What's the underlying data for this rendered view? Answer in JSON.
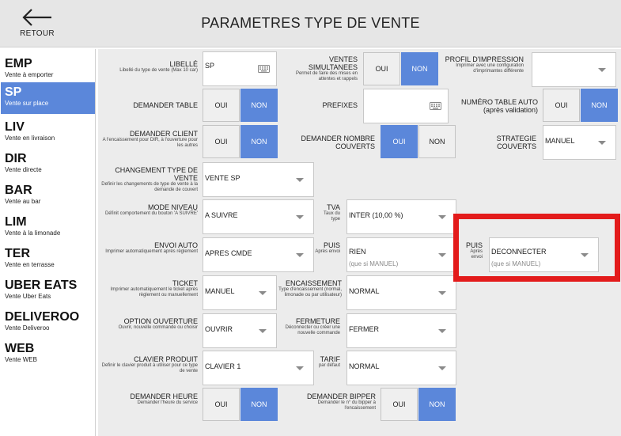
{
  "header": {
    "back_label": "RETOUR",
    "title": "PARAMETRES TYPE DE VENTE"
  },
  "sidebar": {
    "items": [
      {
        "code": "EMP",
        "label": "Vente à emporter"
      },
      {
        "code": "SP",
        "label": "Vente sur place"
      },
      {
        "code": "LIV",
        "label": "Vente en livraison"
      },
      {
        "code": "DIR",
        "label": "Vente directe"
      },
      {
        "code": "BAR",
        "label": "Vente au bar"
      },
      {
        "code": "LIM",
        "label": "Vente à la limonade"
      },
      {
        "code": "TER",
        "label": "Vente en terrasse"
      },
      {
        "code": "UBER EATS",
        "label": "Vente Uber Eats"
      },
      {
        "code": "DELIVEROO",
        "label": "Vente Deliveroo"
      },
      {
        "code": "WEB",
        "label": "Vente WEB"
      }
    ],
    "active_index": 1
  },
  "form": {
    "libelle": {
      "title": "LIBELLÉ",
      "desc": "Libellé du type de vente (Max 10 car)",
      "value": "SP"
    },
    "ventes_simultanees": {
      "title": "VENTES SIMULTANEES",
      "desc": "Permet de faire des mises en attentes et rappels",
      "oui": "OUI",
      "non": "NON"
    },
    "profil_impression": {
      "title": "PROFIL D'IMPRESSION",
      "desc": "Imprimer avec une configuration d'imprimantes différente",
      "value": ""
    },
    "demander_table": {
      "title": "DEMANDER TABLE",
      "oui": "OUI",
      "non": "NON"
    },
    "prefixes": {
      "title": "PREFIXES",
      "value": ""
    },
    "numero_table_auto": {
      "title": "NUMÉRO TABLE AUTO",
      "desc": "(après validation)",
      "oui": "OUI",
      "non": "NON"
    },
    "demander_client": {
      "title": "DEMANDER CLIENT",
      "desc": "A l'encaissement pour DIR, à l'ouverture pour les autres",
      "oui": "OUI",
      "non": "NON"
    },
    "demander_nombre_couverts": {
      "title": "DEMANDER NOMBRE COUVERTS",
      "oui": "OUI",
      "non": "NON"
    },
    "strategie_couverts": {
      "title": "STRATEGIE COUVERTS",
      "value": "MANUEL"
    },
    "changement_type_vente": {
      "title": "CHANGEMENT TYPE DE VENTE",
      "desc": "Definir les changements de type de vente à la demande de couvert",
      "value": "VENTE SP"
    },
    "mode_niveau": {
      "title": "MODE NIVEAU",
      "desc": "Définit comportement du bouton 'A SUIVRE'",
      "value": "A SUIVRE"
    },
    "tva": {
      "title": "TVA",
      "desc": "Taux du type",
      "value": "INTER (10,00 %)"
    },
    "envoi_auto": {
      "title": "ENVOI AUTO",
      "desc": "Imprimer automatiquement après règlement",
      "value": "APRES CMDE"
    },
    "puis_1": {
      "title": "PUIS",
      "desc": "Après envoi",
      "value": "RIEN",
      "hint": "(que si MANUEL)"
    },
    "puis_2": {
      "title": "PUIS",
      "desc": "Après envoi",
      "value": "DECONNECTER",
      "hint": "(que si MANUEL)"
    },
    "ticket": {
      "title": "TICKET",
      "desc": "Imprimer automatiquement le ticket après règlement ou manuellement",
      "value": "MANUEL"
    },
    "encaissement": {
      "title": "ENCAISSEMENT",
      "desc": "Type d'encaissement (normal, limonade ou par utilisateur)",
      "value": "NORMAL"
    },
    "option_ouverture": {
      "title": "OPTION OUVERTURE",
      "desc": "Ouvrir, nouvelle commande ou choisir",
      "value": "OUVRIR"
    },
    "fermeture": {
      "title": "FERMETURE",
      "desc": "Déconnecter ou créer une nouvelle commande",
      "value": "FERMER"
    },
    "clavier_produit": {
      "title": "CLAVIER PRODUIT",
      "desc": "Definir le clavier produit à utiliser pour ce type de vente",
      "value": "CLAVIER 1"
    },
    "tarif": {
      "title": "TARIF",
      "desc": "par défaut",
      "value": "NORMAL"
    },
    "demander_heure": {
      "title": "DEMANDER HEURE",
      "desc": "Demander l'heure du service",
      "oui": "OUI",
      "non": "NON"
    },
    "demander_bipper": {
      "title": "DEMANDER BIPPER",
      "desc": "Demander le n° du bipper à l'encaissement",
      "oui": "OUI",
      "non": "NON"
    }
  },
  "colors": {
    "accent": "#5b87da",
    "highlight": "#e31b1b",
    "panel": "#ececec",
    "header": "#e6e6e6"
  }
}
